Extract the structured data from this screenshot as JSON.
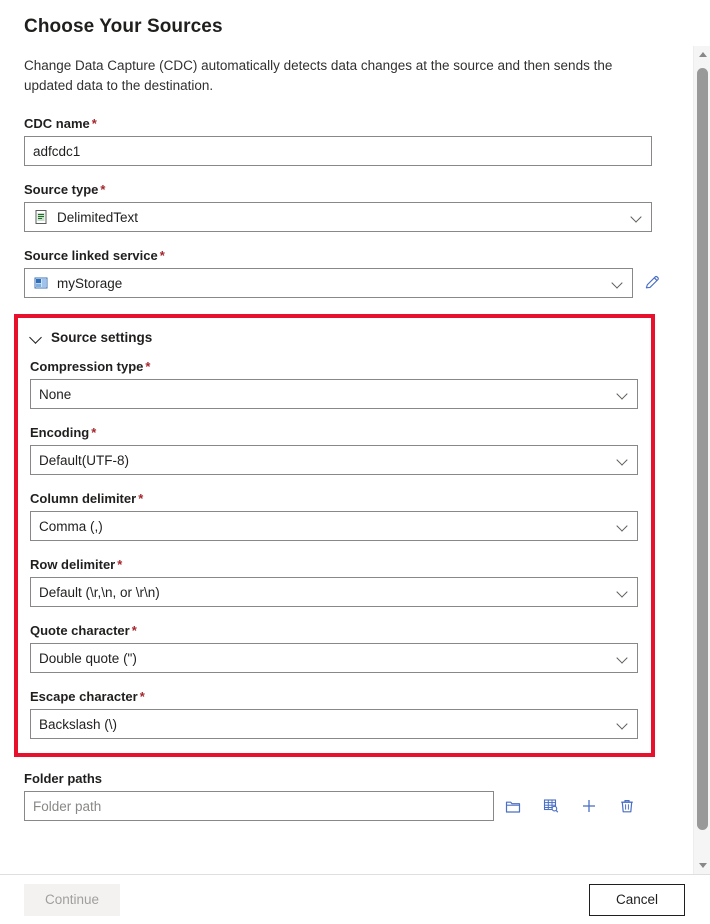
{
  "page": {
    "title": "Choose Your Sources",
    "description": "Change Data Capture (CDC) automatically detects data changes at the source and then sends the updated data to the destination."
  },
  "fields": {
    "cdc_name": {
      "label": "CDC name",
      "required": "*",
      "value": "adfcdc1"
    },
    "source_type": {
      "label": "Source type",
      "required": "*",
      "value": "DelimitedText",
      "icon": "delimited-text-file-icon"
    },
    "source_linked_service": {
      "label": "Source linked service",
      "required": "*",
      "value": "myStorage",
      "icon": "azure-storage-icon",
      "edit_icon": "pencil-edit-icon"
    }
  },
  "source_settings": {
    "heading": "Source settings",
    "expanded_icon": "chevron-down-icon",
    "highlight_color": "#e8112d",
    "items": [
      {
        "label": "Compression type",
        "required": "*",
        "value": "None"
      },
      {
        "label": "Encoding",
        "required": "*",
        "value": "Default(UTF-8)"
      },
      {
        "label": "Column delimiter",
        "required": "*",
        "value": "Comma (,)"
      },
      {
        "label": "Row delimiter",
        "required": "*",
        "value": "Default (\\r,\\n, or \\r\\n)"
      },
      {
        "label": "Quote character",
        "required": "*",
        "value": "Double quote (\")"
      },
      {
        "label": "Escape character",
        "required": "*",
        "value": "Backslash (\\)"
      }
    ]
  },
  "folder_paths": {
    "label": "Folder paths",
    "placeholder": "Folder path",
    "value": "",
    "actions": [
      {
        "name": "browse-folder-icon",
        "title": "Browse"
      },
      {
        "name": "preview-data-icon",
        "title": "Preview data"
      },
      {
        "name": "add-folder-path-icon",
        "title": "Add"
      },
      {
        "name": "delete-folder-path-icon",
        "title": "Delete"
      }
    ]
  },
  "footer": {
    "continue_label": "Continue",
    "continue_disabled": true,
    "cancel_label": "Cancel"
  },
  "scrollbar": {
    "up_icon": "scroll-up-arrow-icon",
    "down_icon": "scroll-down-arrow-icon"
  }
}
